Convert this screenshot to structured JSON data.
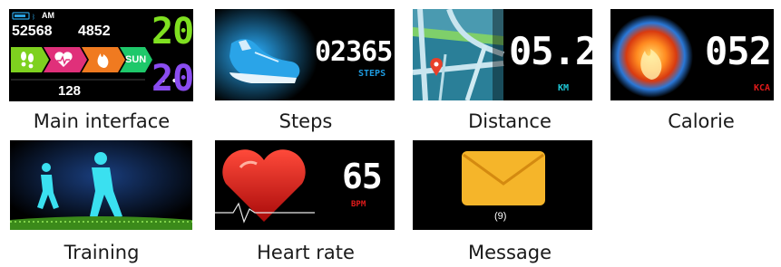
{
  "colors": {
    "steps_unit": "#1e9be0",
    "km_unit": "#1ec8d8",
    "kcal_unit": "#e01a1a",
    "bpm_unit": "#e01a1a",
    "clock_green": "#7fe020",
    "clock_purple": "#8a4cf0",
    "envelope": "#f5b52a"
  },
  "main": {
    "status_time": "AM",
    "value_a": "52568",
    "value_b": "4852",
    "bottom_value": "128",
    "day": "SUN",
    "hour": "20",
    "minute": "20",
    "icons": [
      "footprints-icon",
      "heart-icon",
      "flame-icon"
    ],
    "caption": "Main interface"
  },
  "steps": {
    "value": "02365",
    "unit": "STEPS",
    "caption": "Steps",
    "icon": "shoe-icon"
  },
  "distance": {
    "value": "05.2",
    "unit": "KM",
    "caption": "Distance",
    "icon": "map-icon"
  },
  "calorie": {
    "value": "052",
    "unit": "KCA",
    "caption": "Calorie",
    "icon": "fireball-icon"
  },
  "training": {
    "caption": "Training",
    "icon": "runners-icon"
  },
  "heart": {
    "value": "65",
    "unit": "BPM",
    "caption": "Heart rate",
    "icon": "heart-icon"
  },
  "message": {
    "count": "(9)",
    "caption": "Message",
    "icon": "envelope-icon"
  }
}
